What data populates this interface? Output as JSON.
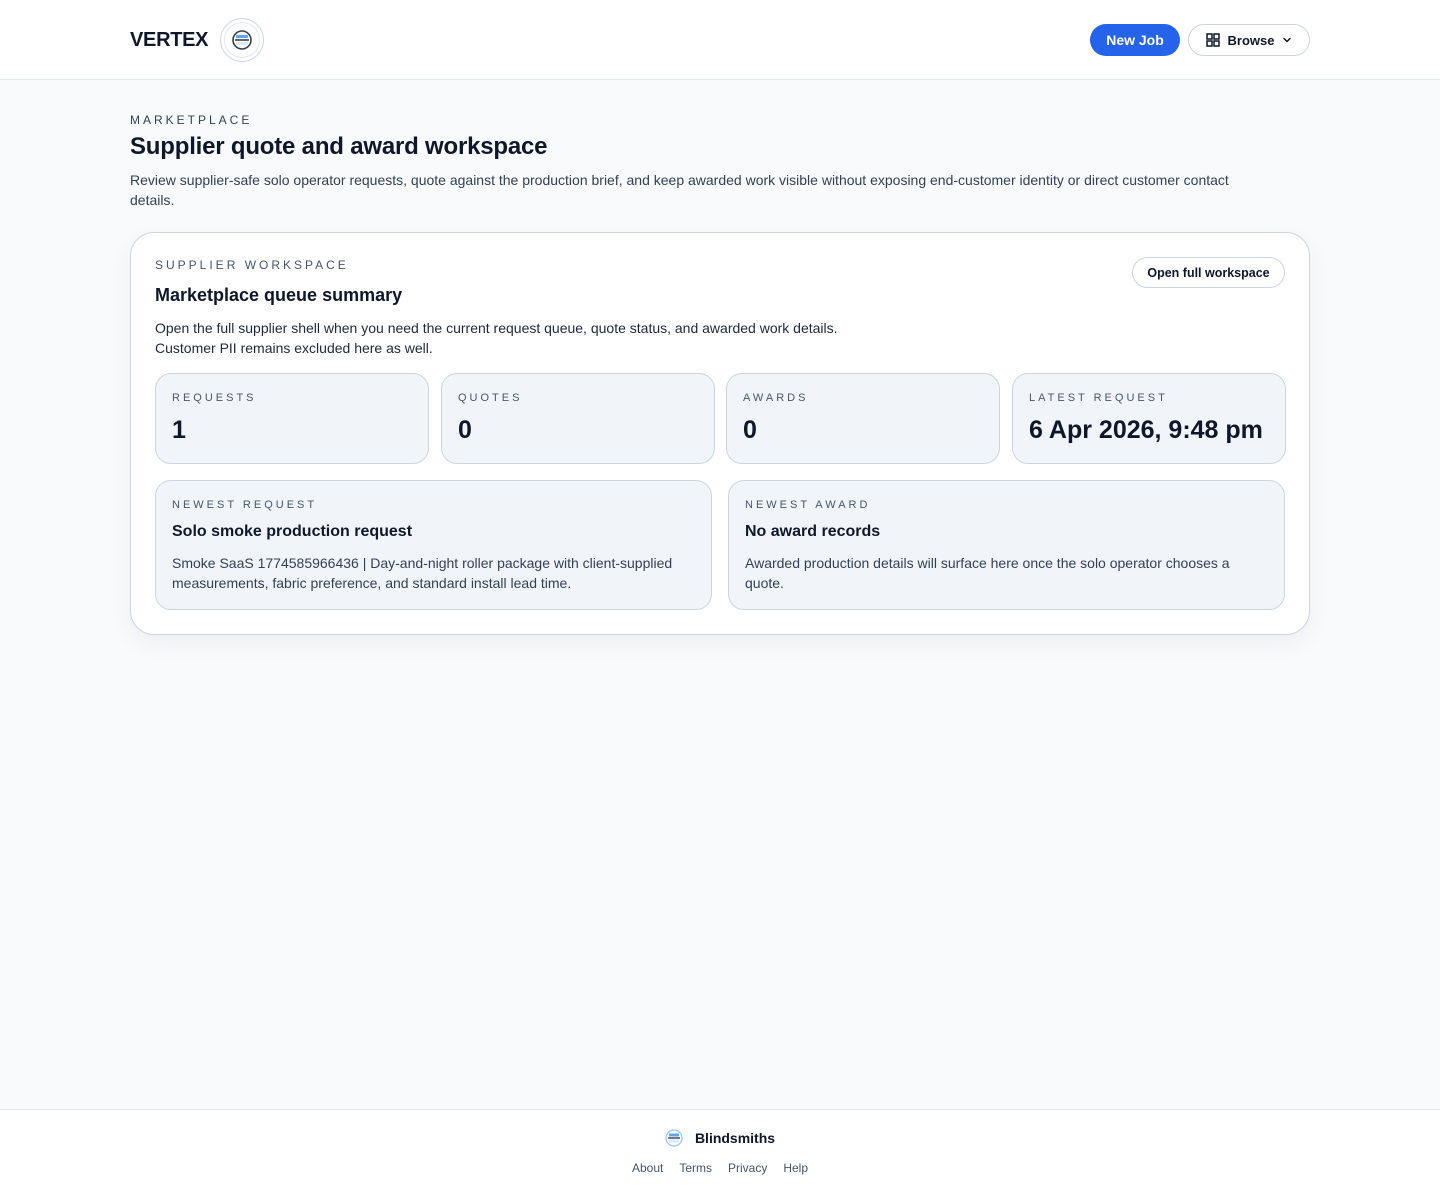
{
  "header": {
    "brand_name": "VERTEX",
    "new_job_label": "New Job",
    "browse_label": "Browse"
  },
  "page": {
    "eyebrow": "MARKETPLACE",
    "title": "Supplier quote and award workspace",
    "description": "Review supplier-safe solo operator requests, quote against the production brief, and keep awarded work visible without exposing end-customer identity or direct customer contact details."
  },
  "workspace": {
    "eyebrow": "SUPPLIER WORKSPACE",
    "title": "Marketplace queue summary",
    "description_line1": "Open the full supplier shell when you need the current request queue, quote status, and awarded work details.",
    "description_line2": "Customer PII remains excluded here as well.",
    "open_button_label": "Open full workspace",
    "stats": [
      {
        "label": "REQUESTS",
        "value": "1"
      },
      {
        "label": "QUOTES",
        "value": "0"
      },
      {
        "label": "AWARDS",
        "value": "0"
      },
      {
        "label": "LATEST REQUEST",
        "value": "6 Apr 2026, 9:48 pm"
      }
    ],
    "newest_request": {
      "label": "NEWEST REQUEST",
      "title": "Solo smoke production request",
      "description": "Smoke SaaS 1774585966436 | Day-and-night roller package with client-supplied measurements, fabric preference, and standard install lead time."
    },
    "newest_award": {
      "label": "NEWEST AWARD",
      "title": "No award records",
      "description": "Awarded production details will surface here once the solo operator chooses a quote."
    }
  },
  "footer": {
    "brand": "Blindsmiths",
    "links": [
      "About",
      "Terms",
      "Privacy",
      "Help"
    ]
  },
  "colors": {
    "accent": "#2563eb",
    "background": "#f8fafc",
    "card_fill": "#f1f5f9",
    "border": "#cbd5e1"
  }
}
